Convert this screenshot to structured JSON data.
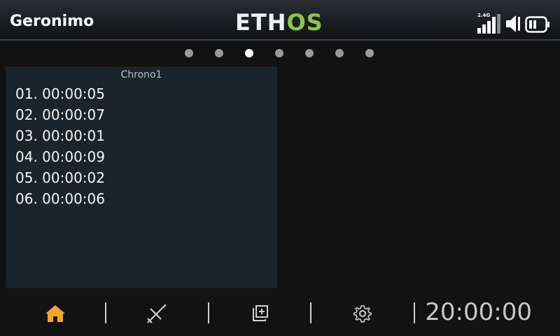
{
  "header": {
    "model_name": "Geronimo",
    "logo_part1": "ETH",
    "logo_part2": "OS",
    "rf_band": "2.4G"
  },
  "pagination": {
    "count": 7,
    "active_index": 2
  },
  "widget": {
    "title": "Chrono1",
    "laps": [
      {
        "num": "01.",
        "time": "00:00:05"
      },
      {
        "num": "02.",
        "time": "00:00:07"
      },
      {
        "num": "03.",
        "time": "00:00:01"
      },
      {
        "num": "04.",
        "time": "00:00:09"
      },
      {
        "num": "05.",
        "time": "00:00:02"
      },
      {
        "num": "06.",
        "time": "00:00:06"
      }
    ]
  },
  "bottombar": {
    "items": [
      "home-icon",
      "model-icon",
      "widgets-icon",
      "settings-icon"
    ],
    "clock": "20:00:00"
  },
  "colors": {
    "accent": "#f5a623",
    "logo_green": "#8cc63f",
    "panel_bg": "#1b232b"
  }
}
